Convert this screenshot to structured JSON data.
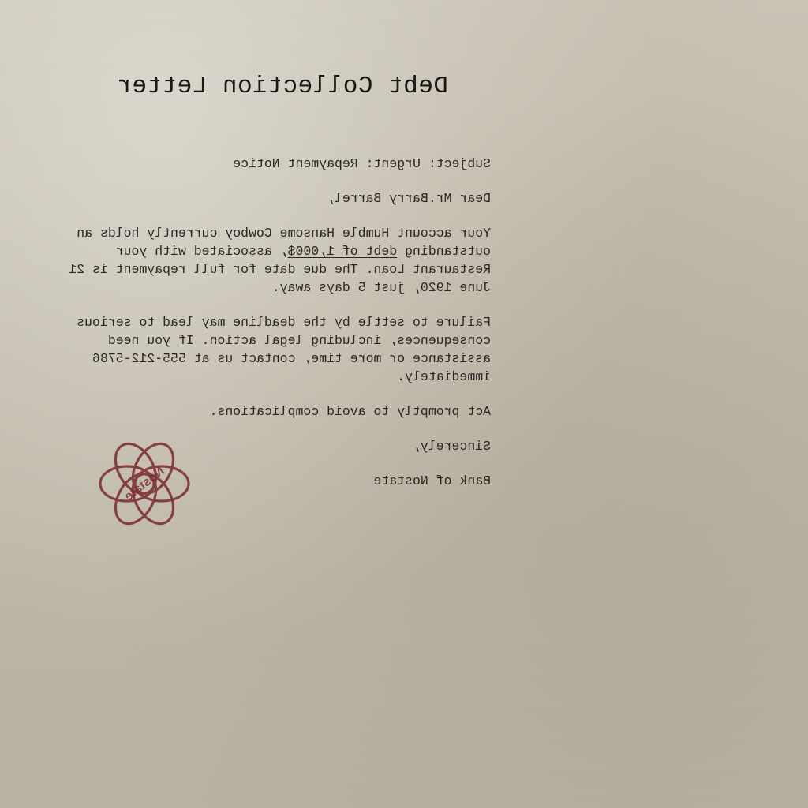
{
  "letter": {
    "title": "Debt Collection Letter",
    "subject": "Subject: Urgent: Repayment Notice",
    "greeting": "Dear Mr.Barry Barrel,",
    "p1": {
      "a": "Your account Humble Hansome Cowboy  currently holds an outstanding ",
      "debt": "debt of 1,000$",
      "b": ", associated with your Restaurant Loan. The due date for full repayment is 21 June 1920, just ",
      "days": "5 days",
      "c": " away."
    },
    "p2": "Failure to settle by the deadline may lead to serious consequences, including legal action. If you need assistance or more time, contact us at 555-212-5786 immediately.",
    "p3": "Act promptly to avoid complications.",
    "closing": "Sincerely,",
    "signature": "Bank of Nostate"
  },
  "stamp": {
    "text": "Nostate",
    "color": "#7a2a2c"
  }
}
